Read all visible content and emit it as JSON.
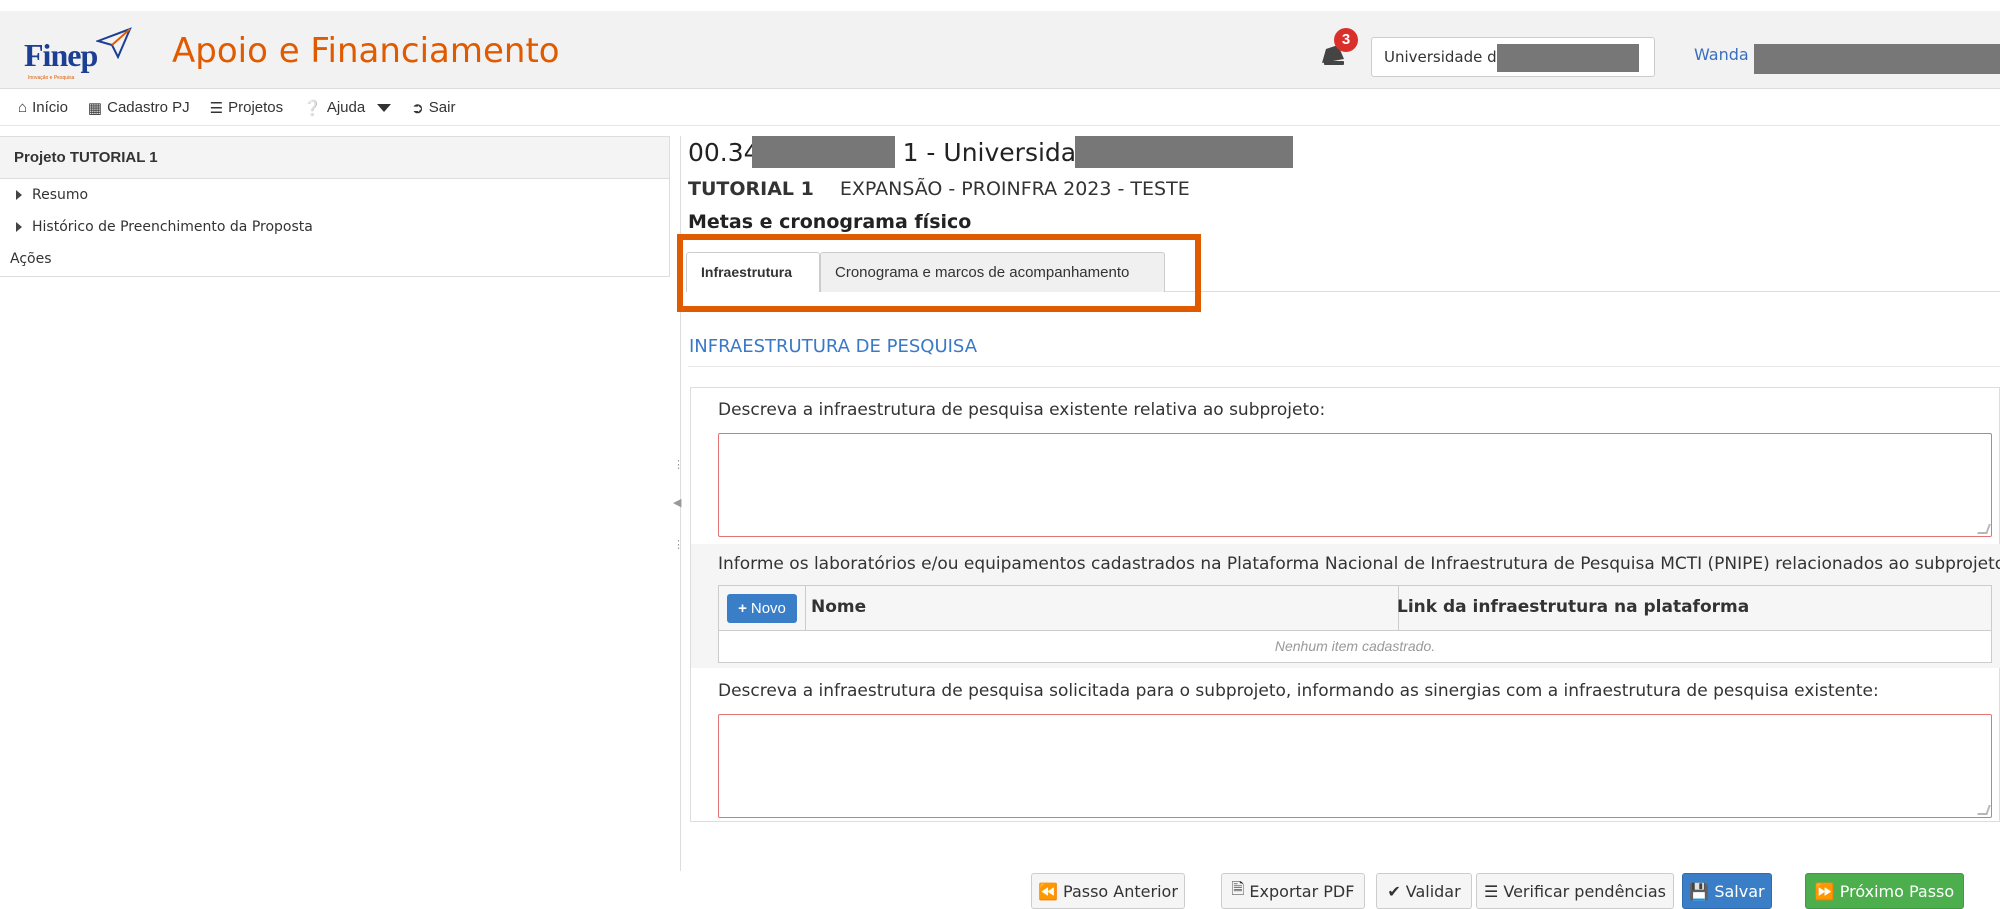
{
  "header": {
    "logo_text": "Finep",
    "logo_tagline": "Inovação e Pesquisa",
    "app_title": "Apoio e Financiamento",
    "notification_count": "3",
    "institution_select_value": "Universidade d",
    "user_name": "Wanda ."
  },
  "menu": [
    {
      "label": "Início",
      "icon": "home-icon"
    },
    {
      "label": "Cadastro PJ",
      "icon": "building-icon"
    },
    {
      "label": "Projetos",
      "icon": "list-icon"
    },
    {
      "label": "Ajuda",
      "icon": "question-circle-icon"
    },
    {
      "label": "Sair",
      "icon": "sign-out-icon"
    }
  ],
  "left_panel": {
    "title": "Projeto TUTORIAL 1",
    "items": [
      "Resumo",
      "Histórico de Preenchimento da Proposta"
    ],
    "actions_label": "Ações"
  },
  "main": {
    "code_prefix": "00.34",
    "code_suffix": "1 - Universidade",
    "project_name": "TUTORIAL 1",
    "program": "EXPANSÃO - PROINFRA 2023 - TESTE",
    "step_title": "Metas e cronograma físico",
    "tabs": [
      {
        "label": "Infraestrutura",
        "active": true
      },
      {
        "label": "Cronograma e marcos de acompanhamento",
        "active": false
      }
    ],
    "section_title": "INFRAESTRUTURA DE PESQUISA",
    "field1_label": "Descreva a infraestrutura de pesquisa existente relativa ao subprojeto:",
    "field1_value": "",
    "field2_label": "Informe os laboratórios e/ou equipamentos cadastrados na Plataforma Nacional de Infraestrutura de Pesquisa MCTI (PNIPE) relacionados ao subprojeto:",
    "grid": {
      "new_button": "Novo",
      "columns": [
        "Nome",
        "Link da infraestrutura na plataforma"
      ],
      "empty_text": "Nenhum item cadastrado."
    },
    "field3_label": "Descreva a infraestrutura de pesquisa solicitada para o subprojeto, informando as sinergias com a infraestrutura de pesquisa existente:",
    "field3_value": ""
  },
  "toolbar": {
    "prev": "Passo Anterior",
    "export": "Exportar PDF",
    "validate": "Validar",
    "check": "Verificar pendências",
    "save": "Salvar",
    "next": "Próximo Passo"
  },
  "colors": {
    "accent_orange": "#e05a00",
    "link_blue": "#3a78c8",
    "primary_blue": "#3a7ec8",
    "success_green": "#4cae4c",
    "badge_red": "#d9302c"
  }
}
